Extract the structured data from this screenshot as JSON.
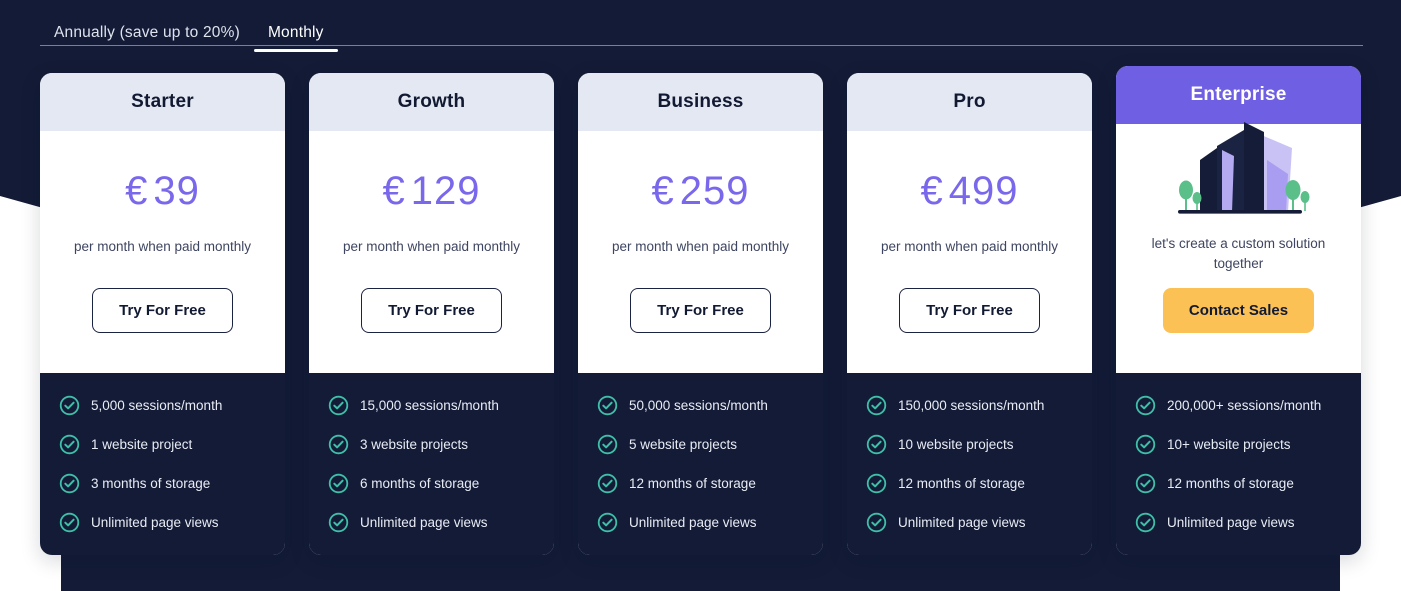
{
  "colors": {
    "background_dark": "#131b36",
    "background_light": "#ffffff",
    "price_purple": "#7a68ec",
    "enterprise_header": "#6f5fe2",
    "cta_yellow": "#fbc155",
    "check_teal": "#3fbfa8",
    "card_header_gray": "#e4e8f2"
  },
  "tabs": [
    {
      "label": "Annually (save up to 20%)",
      "active": false
    },
    {
      "label": "Monthly",
      "active": true
    }
  ],
  "plans": [
    {
      "name": "Starter",
      "currency": "€",
      "price": "39",
      "period_note": "per month when paid monthly",
      "cta": "Try For Free",
      "features": [
        "5,000 sessions/month",
        "1 website project",
        "3 months of storage",
        "Unlimited page views"
      ]
    },
    {
      "name": "Growth",
      "currency": "€",
      "price": "129",
      "period_note": "per month when paid monthly",
      "cta": "Try For Free",
      "features": [
        "15,000 sessions/month",
        "3 website projects",
        "6 months of storage",
        "Unlimited page views"
      ]
    },
    {
      "name": "Business",
      "currency": "€",
      "price": "259",
      "period_note": "per month when paid monthly",
      "cta": "Try For Free",
      "features": [
        "50,000 sessions/month",
        "5 website projects",
        "12 months of storage",
        "Unlimited page views"
      ]
    },
    {
      "name": "Pro",
      "currency": "€",
      "price": "499",
      "period_note": "per month when paid monthly",
      "cta": "Try For Free",
      "features": [
        "150,000 sessions/month",
        "10 website projects",
        "12 months of storage",
        "Unlimited page views"
      ]
    }
  ],
  "enterprise": {
    "name": "Enterprise",
    "illustration": "city-buildings-icon",
    "tagline": "let's create a custom solution together",
    "cta": "Contact Sales",
    "features": [
      "200,000+ sessions/month",
      "10+ website projects",
      "12 months of storage",
      "Unlimited page views"
    ]
  },
  "icons": {
    "check": "check-circle-icon"
  }
}
